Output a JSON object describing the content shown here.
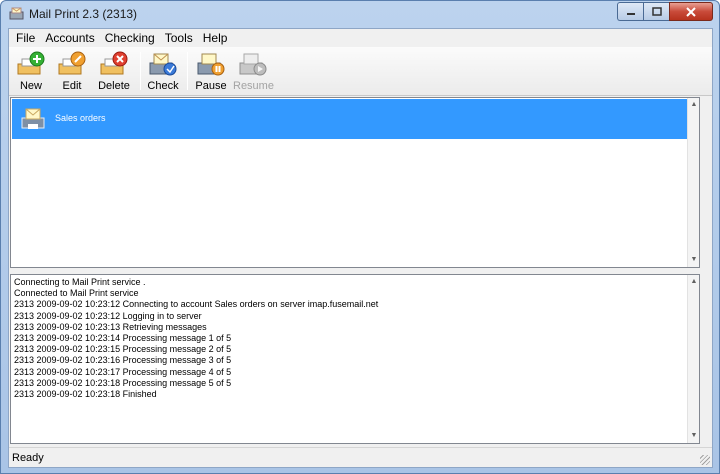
{
  "window": {
    "title": "Mail Print 2.3 (2313)"
  },
  "menu": [
    "File",
    "Accounts",
    "Checking",
    "Tools",
    "Help"
  ],
  "toolbar": {
    "new": "New",
    "edit": "Edit",
    "delete": "Delete",
    "check": "Check",
    "pause": "Pause",
    "resume": "Resume"
  },
  "accounts": [
    {
      "label": "Sales orders",
      "icon": "mail-printer-icon",
      "selected": true
    }
  ],
  "log": [
    "Connecting to Mail Print service .",
    "Connected to Mail Print service",
    "2313 2009-09-02 10:23:12 Connecting to account Sales orders on server imap.fusemail.net",
    "2313 2009-09-02 10:23:12 Logging in to server",
    "2313 2009-09-02 10:23:13 Retrieving messages",
    "2313 2009-09-02 10:23:14 Processing message 1 of 5",
    "2313 2009-09-02 10:23:15 Processing message 2 of 5",
    "2313 2009-09-02 10:23:16 Processing message 3 of 5",
    "2313 2009-09-02 10:23:17 Processing message 4 of 5",
    "2313 2009-09-02 10:23:18 Processing message 5 of 5",
    "2313 2009-09-02 10:23:18 Finished"
  ],
  "status": "Ready",
  "colors": {
    "selection": "#3399ff",
    "titlebar": "#bcd3ee",
    "close": "#c94b3a"
  }
}
